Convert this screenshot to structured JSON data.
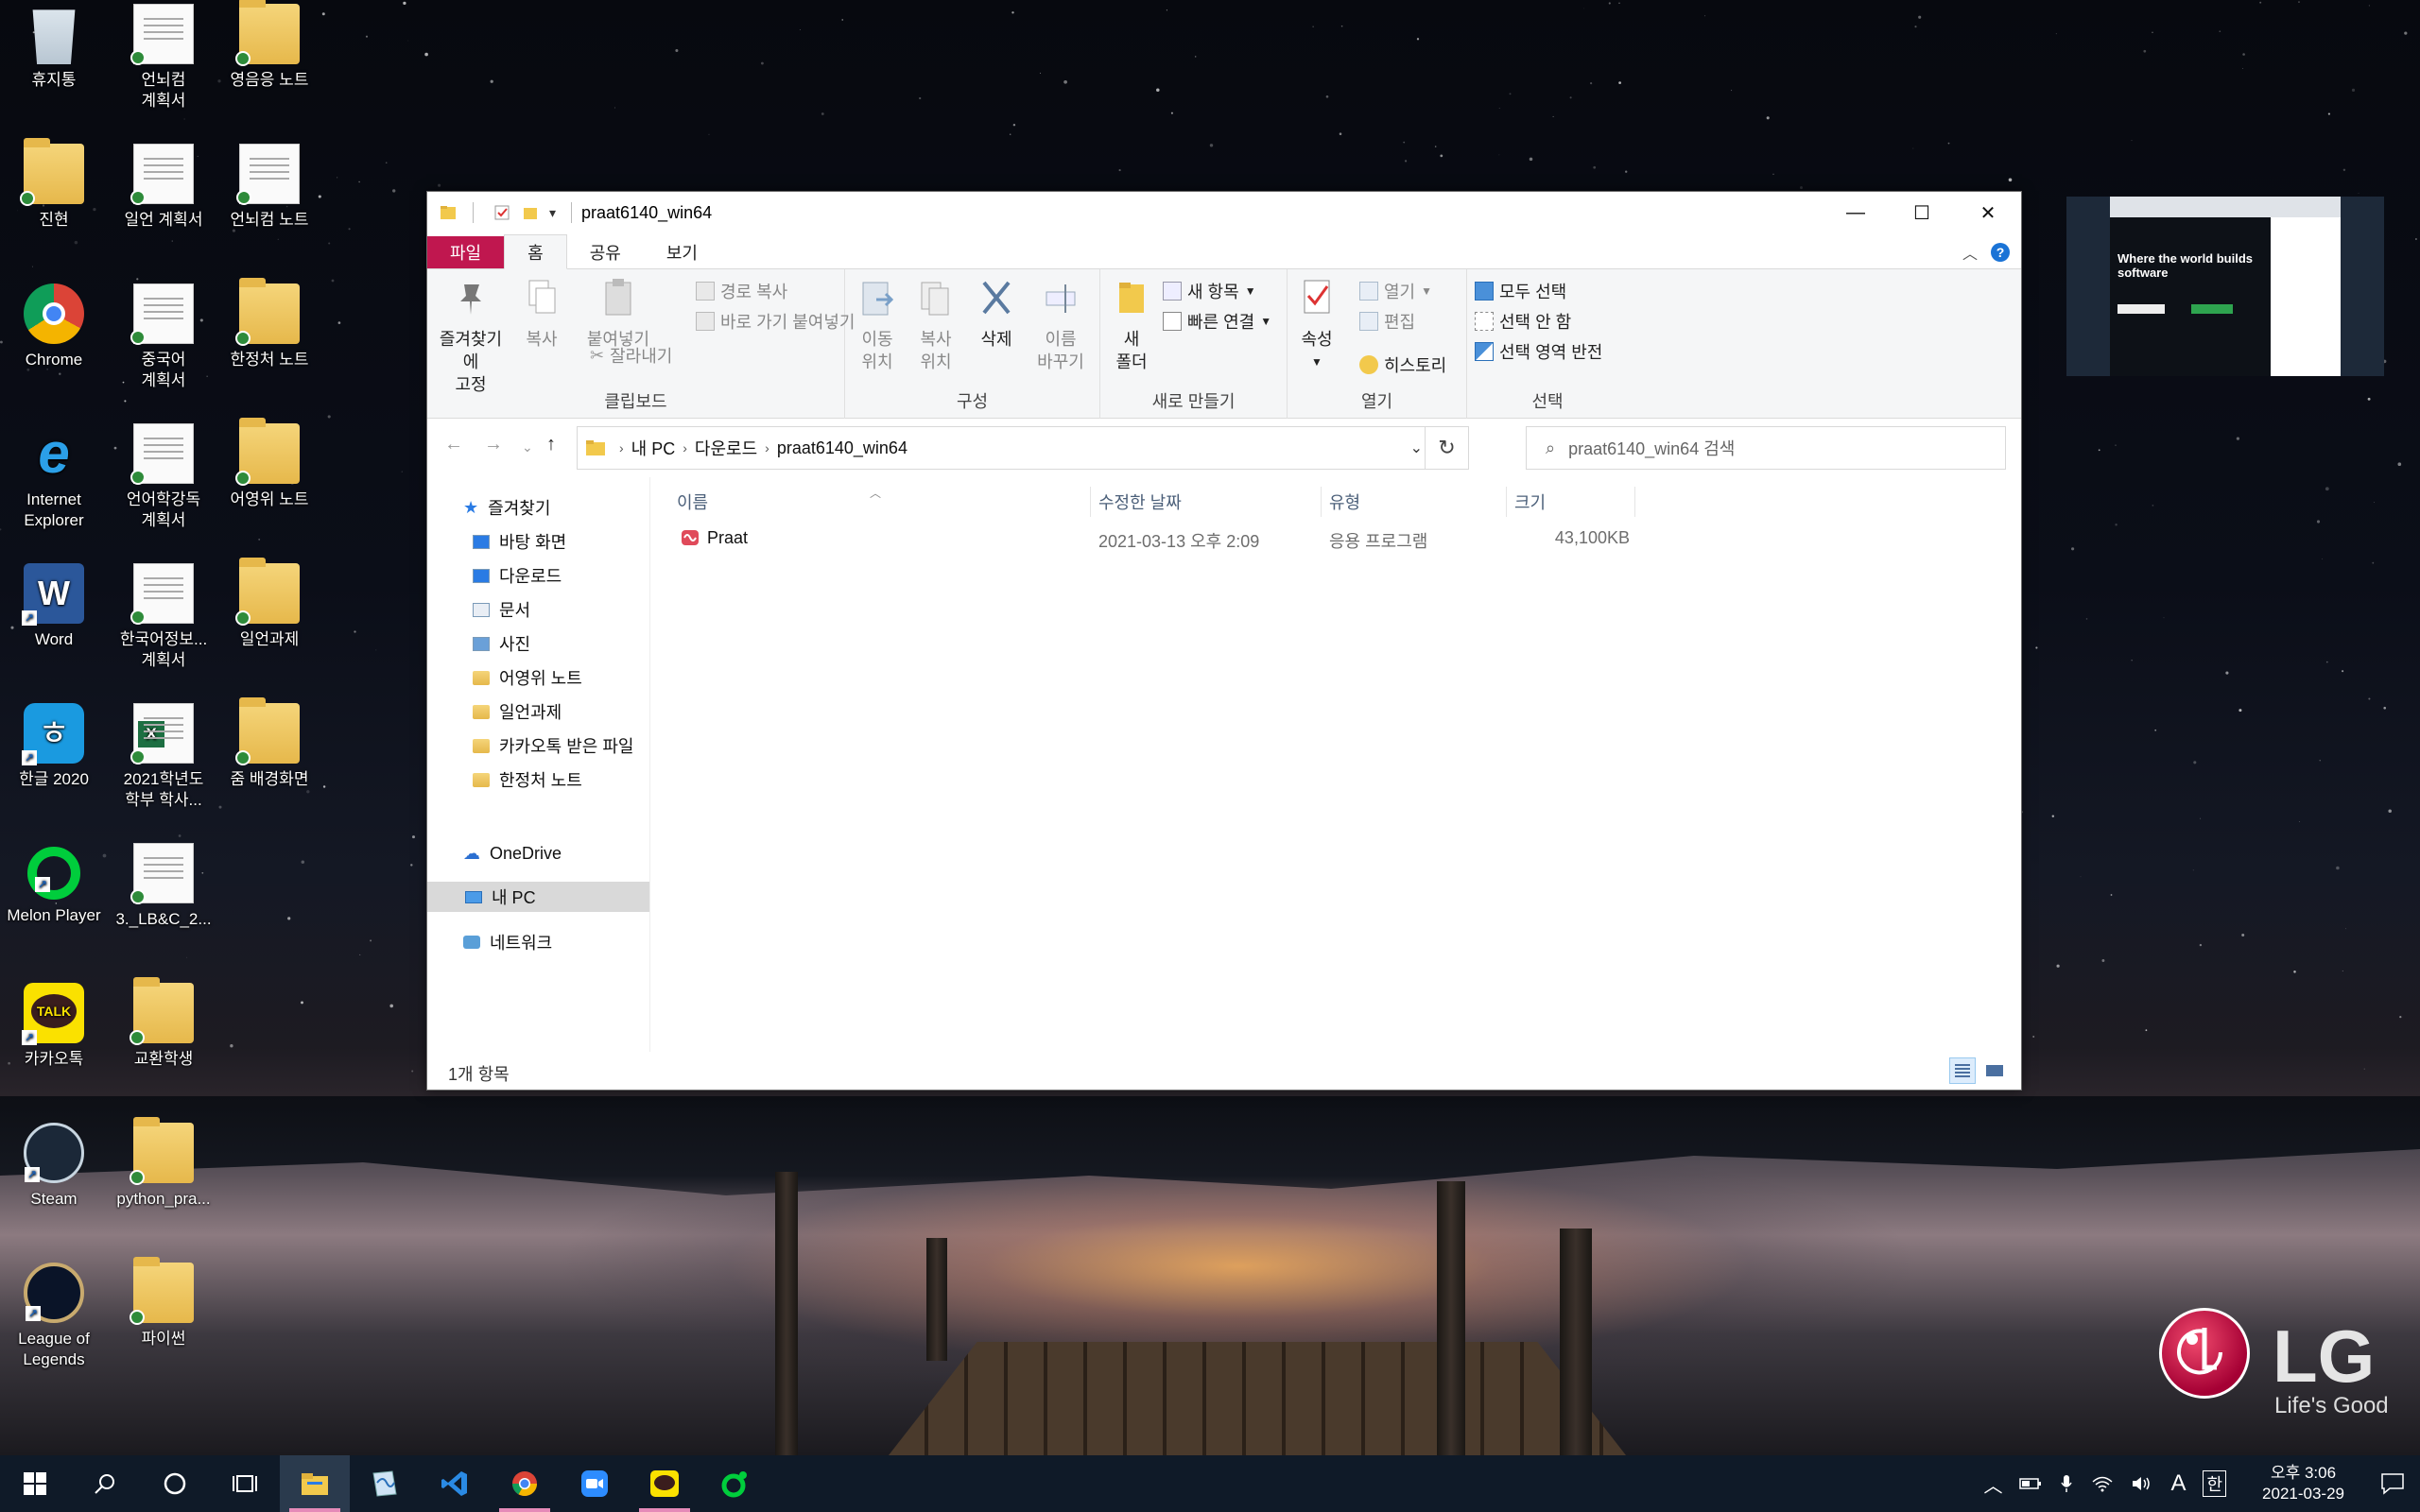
{
  "desktop": {
    "icons": [
      {
        "label": "휴지통"
      },
      {
        "label": "언뇌컴\n계획서"
      },
      {
        "label": "영음응 노트"
      },
      {
        "label": "진현"
      },
      {
        "label": "일언 계획서"
      },
      {
        "label": "언뇌컴 노트"
      },
      {
        "label": "Chrome"
      },
      {
        "label": "중국어\n계획서"
      },
      {
        "label": "한정처 노트"
      },
      {
        "label": "Internet\nExplorer"
      },
      {
        "label": "언어학강독\n계획서"
      },
      {
        "label": "어영위 노트"
      },
      {
        "label": "Word"
      },
      {
        "label": "한국어정보...\n계획서"
      },
      {
        "label": "일언과제"
      },
      {
        "label": "한글 2020"
      },
      {
        "label": "2021학년도\n학부 학사..."
      },
      {
        "label": "줌 배경화면"
      },
      {
        "label": "Melon Player"
      },
      {
        "label": "3._LB&C_2..."
      },
      {
        "label": "카카오톡"
      },
      {
        "label": "교환학생"
      },
      {
        "label": "Steam"
      },
      {
        "label": "python_pra..."
      },
      {
        "label": "League of\nLegends"
      },
      {
        "label": "파이썬"
      }
    ]
  },
  "window": {
    "title": "praat6140_win64",
    "tabs": {
      "file": "파일",
      "home": "홈",
      "share": "공유",
      "view": "보기"
    },
    "ribbon": {
      "clipboard": {
        "label": "클립보드",
        "pin": "즐겨찾기에\n고정",
        "copy": "복사",
        "paste": "붙여넣기",
        "copy_path": "경로 복사",
        "paste_shortcut": "바로 가기 붙여넣기",
        "cut": "잘라내기"
      },
      "organize": {
        "label": "구성",
        "move": "이동\n위치",
        "copy_to": "복사\n위치",
        "delete": "삭제",
        "rename": "이름\n바꾸기"
      },
      "new": {
        "label": "새로 만들기",
        "new_folder": "새\n폴더",
        "new_item": "새 항목",
        "easy_access": "빠른 연결"
      },
      "open": {
        "label": "열기",
        "properties": "속성",
        "open": "열기",
        "edit": "편집",
        "history": "히스토리"
      },
      "select": {
        "label": "선택",
        "select_all": "모두 선택",
        "select_none": "선택 안 함",
        "invert": "선택 영역 반전"
      }
    },
    "address": {
      "crumbs": [
        "내 PC",
        "다운로드",
        "praat6140_win64"
      ],
      "search_placeholder": "praat6140_win64 검색"
    },
    "nav": {
      "quick_access": "즐겨찾기",
      "items": [
        "바탕 화면",
        "다운로드",
        "문서",
        "사진",
        "어영위 노트",
        "일언과제",
        "카카오톡 받은 파일",
        "한정처 노트"
      ],
      "onedrive": "OneDrive",
      "this_pc": "내 PC",
      "network": "네트워크"
    },
    "columns": {
      "name": "이름",
      "modified": "수정한 날짜",
      "type": "유형",
      "size": "크기"
    },
    "files": [
      {
        "name": "Praat",
        "modified": "2021-03-13 오후 2:09",
        "type": "응용 프로그램",
        "size": "43,100KB"
      }
    ],
    "status": "1개 항목"
  },
  "thumbnail": {
    "headline": "Where the world builds software"
  },
  "lg": {
    "brand": "LG",
    "tagline": "Life's Good"
  },
  "taskbar": {
    "time": "오후 3:06",
    "date": "2021-03-29",
    "ime": "A",
    "ime2": "한"
  },
  "colors": {
    "file_tab": "#c0174f",
    "accent": "#1a73d6",
    "taskbar": "#0f1a28",
    "highlight": "#e58ab8"
  }
}
